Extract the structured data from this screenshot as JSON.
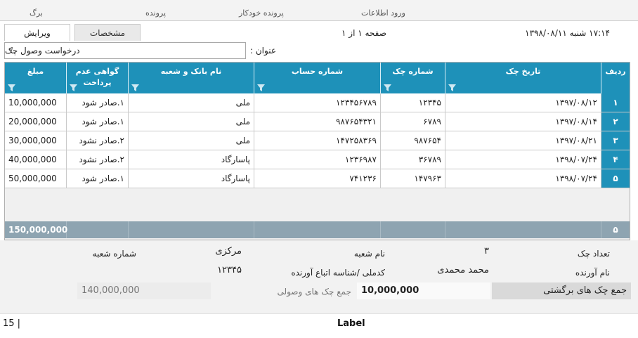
{
  "top_tabs": [
    "برگ",
    "پرونده",
    "پرونده خودکار",
    "ورود اطلاعات"
  ],
  "tabs": [
    {
      "label": "ویرایش",
      "active": true
    },
    {
      "label": "مشخصات",
      "active": false
    }
  ],
  "page_info": "صفحه ۱ از ۱",
  "datetime": "۱۷:۱۴   شنبه ۱۳۹۸/۰۸/۱۱",
  "title": {
    "label": "عنوان :",
    "value": "درخواست وصول چک"
  },
  "grid": {
    "headers": {
      "rowno": "ردیف",
      "date": "تاریخ چک",
      "check_no": "شماره چک",
      "account": "شماره حساب",
      "bank": "نام بانک و شعبه",
      "non_payment": "گواهی عدم پرداخت",
      "amount": "مبلغ"
    },
    "rows": [
      {
        "rowno": "۱",
        "date": "۱۳۹۷/۰۸/۱۲",
        "check_no": "۱۲۳۴۵",
        "account": "۱۲۳۴۵۶۷۸۹",
        "bank": "ملی",
        "non_payment": "۱.صادر شود",
        "amount": "10,000,000"
      },
      {
        "rowno": "۲",
        "date": "۱۳۹۷/۰۸/۱۴",
        "check_no": "۶۷۸۹",
        "account": "۹۸۷۶۵۴۳۲۱",
        "bank": "ملی",
        "non_payment": "۱.صادر شود",
        "amount": "20,000,000"
      },
      {
        "rowno": "۳",
        "date": "۱۳۹۷/۰۸/۲۱",
        "check_no": "۹۸۷۶۵۴",
        "account": "۱۴۷۲۵۸۳۶۹",
        "bank": "ملی",
        "non_payment": "۲.صادر نشود",
        "amount": "30,000,000"
      },
      {
        "rowno": "۴",
        "date": "۱۳۹۸/۰۷/۲۴",
        "check_no": "۳۶۷۸۹",
        "account": "۱۲۳۶۹۸۷",
        "bank": "پاسارگاد",
        "non_payment": "۲.صادر نشود",
        "amount": "40,000,000"
      },
      {
        "rowno": "۵",
        "date": "۱۳۹۸/۰۷/۲۴",
        "check_no": "۱۴۷۹۶۳",
        "account": "۷۴۱۲۳۶",
        "bank": "پاسارگاد",
        "non_payment": "۱.صادر شود",
        "amount": "50,000,000"
      }
    ],
    "total": {
      "amount": "150,000,000",
      "count": "۵"
    }
  },
  "panel": {
    "check_count_label": "تعداد چک",
    "check_count_value": "۳",
    "branch_name_label": "نام شعبه",
    "branch_name_value": "مرکزی",
    "branch_no_label": "شماره شعبه",
    "branch_no_value": "۱۲۳۴۵",
    "bringer_name_label": "نام آورنده",
    "bringer_name_value": "محمد محمدی",
    "national_id_label": "کدملی /شناسه اتباع آورنده",
    "returned_label": "جمع چک های برگشتی",
    "returned_value": "10,000,000",
    "collected_label": "جمع چک های وصولی",
    "collected_value": "140,000,000"
  },
  "footer": {
    "left": "15 |",
    "center": "Label"
  },
  "colors": {
    "header": "#1e91b9",
    "total": "#8ea4b1"
  }
}
